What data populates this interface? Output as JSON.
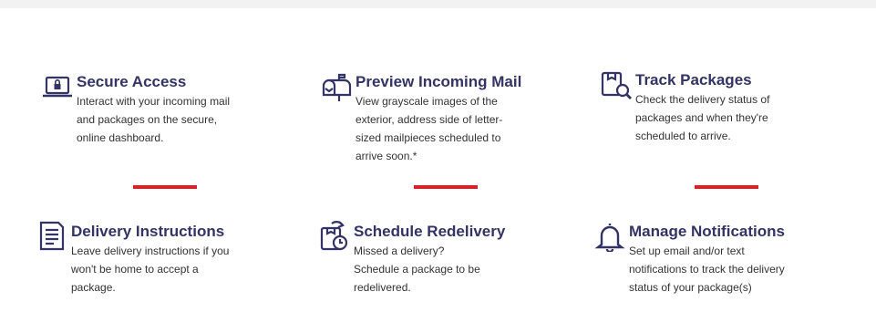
{
  "colors": {
    "title": "#333366",
    "body_text": "#333333",
    "divider": "#e71921",
    "icon": "#333366",
    "top_bar": "#f2f2f2"
  },
  "features": [
    {
      "icon": "laptop-lock-icon",
      "title": "Secure Access",
      "desc_lines": [
        "Interact with your incoming mail",
        "and packages on the secure,",
        "online dashboard."
      ]
    },
    {
      "icon": "mailbox-icon",
      "title": "Preview Incoming Mail",
      "desc_lines": [
        "View grayscale images of the",
        "exterior, address side of letter-",
        "sized mailpieces scheduled to",
        "arrive soon.*"
      ]
    },
    {
      "icon": "package-search-icon",
      "title": "Track Packages",
      "desc_lines": [
        "Check the delivery status of",
        "packages and when they're",
        "scheduled to arrive."
      ]
    },
    {
      "icon": "document-icon",
      "title": "Delivery Instructions",
      "desc_lines": [
        "Leave delivery instructions if you",
        "won't be home to accept a",
        "package."
      ]
    },
    {
      "icon": "package-clock-icon",
      "title": "Schedule Redelivery",
      "desc_lines": [
        "Missed a delivery?",
        "Schedule a package to be",
        "redelivered."
      ]
    },
    {
      "icon": "bell-icon",
      "title": "Manage Notifications",
      "desc_lines": [
        "Set up email and/or text",
        "notifications to track the delivery",
        "status of your package(s)"
      ]
    }
  ]
}
